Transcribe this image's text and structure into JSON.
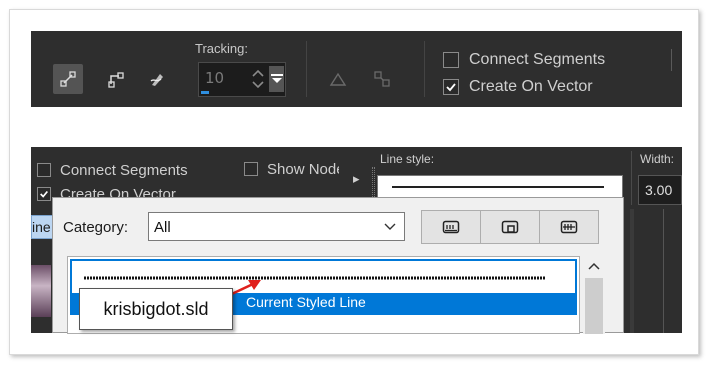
{
  "toolbar_top": {
    "tracking_label": "Tracking:",
    "tracking_value": "10",
    "tracking_progress": 0.1,
    "connect_segments": {
      "label": "Connect Segments",
      "checked": false
    },
    "create_on_vector": {
      "label": "Create On Vector",
      "checked": true
    }
  },
  "property_bar": {
    "connect_segments": {
      "label": "Connect Segments",
      "checked": false
    },
    "create_on_vector": {
      "label": "Create On Vector",
      "checked": true
    },
    "show_nodes": {
      "label": "Show Node",
      "checked": false
    },
    "overflow_arrow": "▸",
    "line_style_label": "Line style:",
    "width_label": "Width:",
    "width_value": "3.00",
    "left_tab_fragment": "ine"
  },
  "line_style_popup": {
    "category_label": "Category:",
    "category_value": "All",
    "selected_item_label": "Current Styled Line"
  },
  "callout": {
    "text": "krisbigdot.sld"
  },
  "colors": {
    "toolbar_bg": "#2e2e2e",
    "selection_blue": "#0078d7",
    "arrow_red": "#e0201c"
  }
}
